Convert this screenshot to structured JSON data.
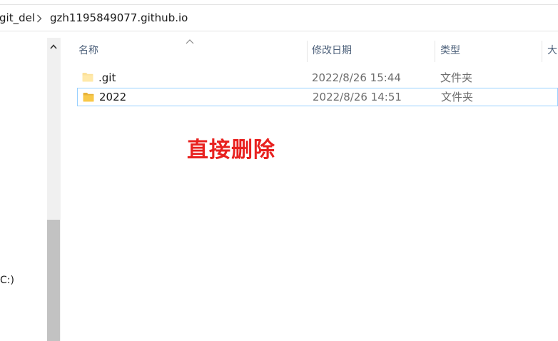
{
  "breadcrumb": {
    "items": [
      "git_del",
      "gzh1195849077.github.io"
    ]
  },
  "nav_pane": {
    "visible_text": "C:)"
  },
  "columns": {
    "name": "名称",
    "date_modified": "修改日期",
    "type": "类型",
    "size": "大"
  },
  "files": [
    {
      "name": ".git",
      "date_modified": "2022/8/26 15:44",
      "type": "文件夹",
      "icon": "folder-icon",
      "hidden": true
    },
    {
      "name": "2022",
      "date_modified": "2022/8/26 14:51",
      "type": "文件夹",
      "icon": "folder-icon",
      "selected_outline": true
    }
  ],
  "annotation": {
    "text": "直接删除",
    "color": "#e8211f"
  },
  "colors": {
    "header_text": "#4c607a",
    "selection_border": "#99d1ff",
    "folder_yellow": "#f8c94a",
    "scrollbar_track": "#f0f0f0",
    "scrollbar_thumb": "#c2c2c2"
  }
}
